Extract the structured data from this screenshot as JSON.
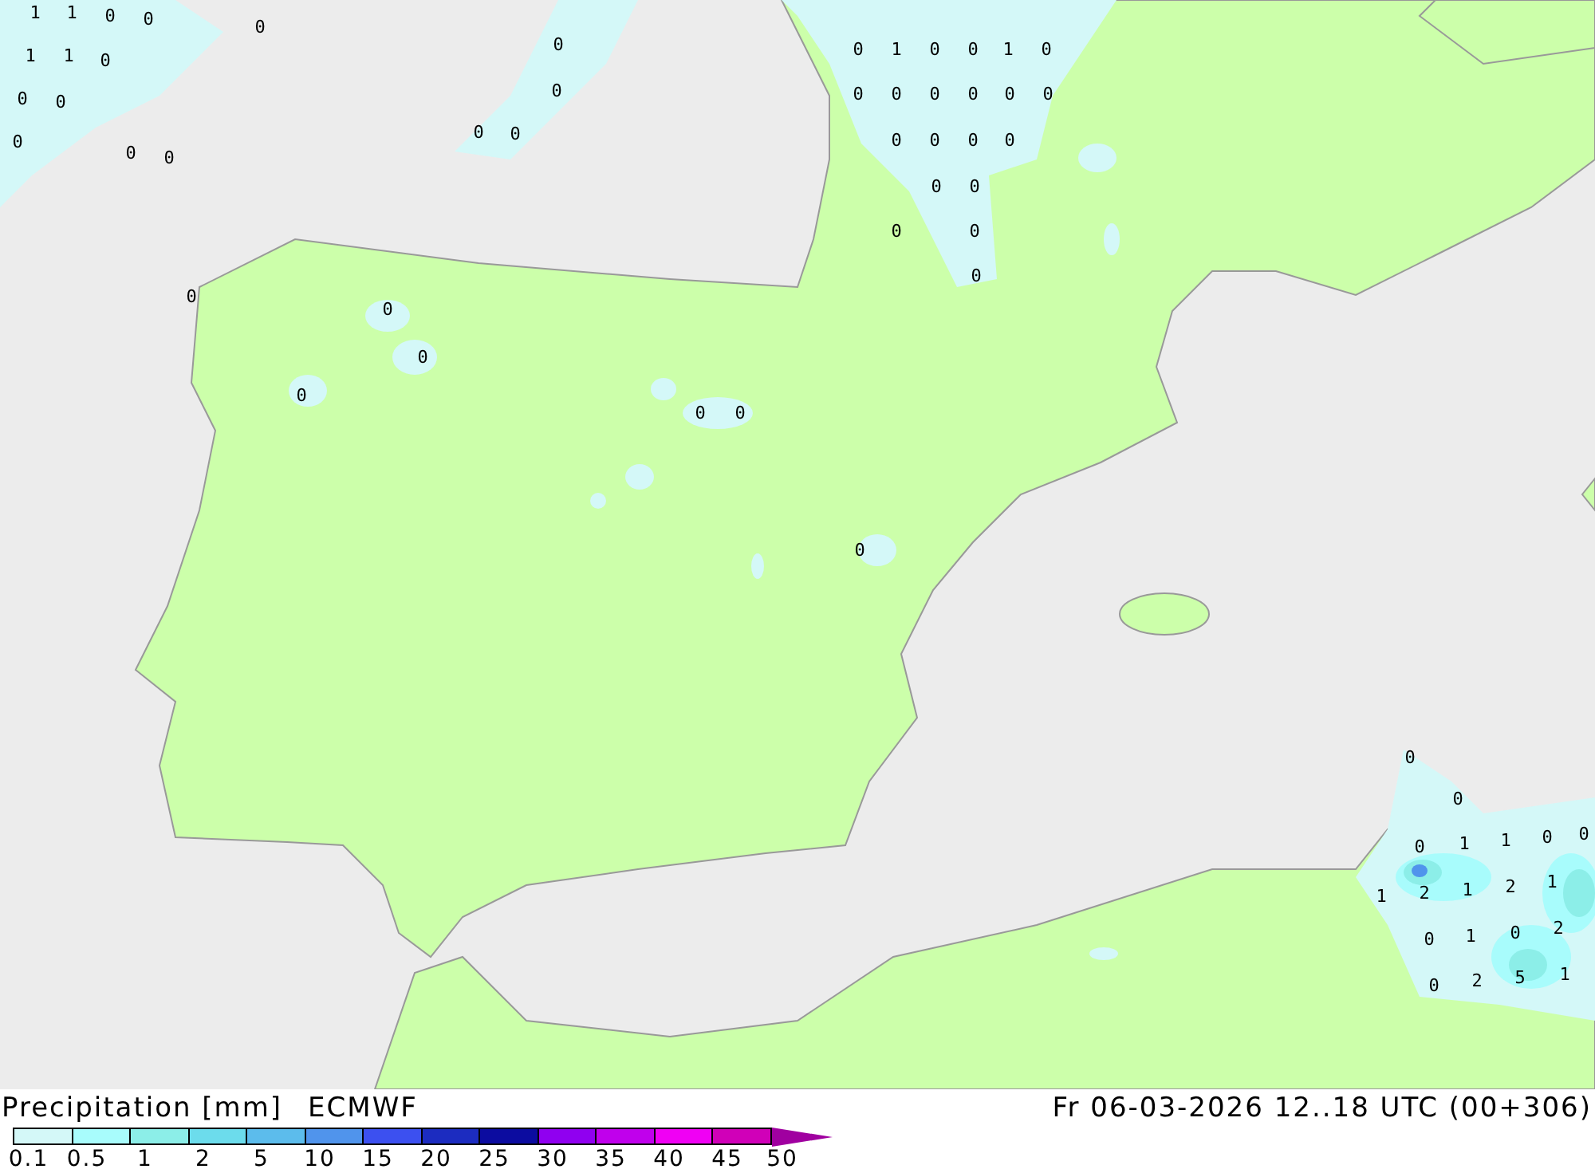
{
  "map": {
    "value_labels": [
      "1",
      "1",
      "0",
      "0",
      "1",
      "1",
      "0",
      "0",
      "0",
      "0",
      "0",
      "0",
      "0",
      "0",
      "0",
      "0",
      "0",
      "0",
      "1",
      "0",
      "0",
      "1",
      "0",
      "0",
      "0",
      "0",
      "0",
      "0",
      "0",
      "0",
      "0",
      "0",
      "0",
      "0",
      "0",
      "0",
      "0",
      "0",
      "0",
      "0",
      "0",
      "0",
      "0",
      "0",
      "0",
      "0",
      "0",
      "0",
      "1",
      "1",
      "0",
      "0",
      "1",
      "2",
      "1",
      "2",
      "1",
      "0",
      "1",
      "0",
      "2",
      "0",
      "2",
      "5",
      "1"
    ]
  },
  "legend": {
    "title": "Precipitation [mm]",
    "model": "ECMWF",
    "items": [
      {
        "label": "0.1",
        "color": "#d4f8f8"
      },
      {
        "label": "0.5",
        "color": "#a8fcfc"
      },
      {
        "label": "1",
        "color": "#8ceee8"
      },
      {
        "label": "2",
        "color": "#6cdcec"
      },
      {
        "label": "5",
        "color": "#5cbcec"
      },
      {
        "label": "10",
        "color": "#5094ec"
      },
      {
        "label": "15",
        "color": "#3c50f0"
      },
      {
        "label": "20",
        "color": "#1c2cc0"
      },
      {
        "label": "25",
        "color": "#0c0ca0"
      },
      {
        "label": "30",
        "color": "#9000f0"
      },
      {
        "label": "35",
        "color": "#c000ec"
      },
      {
        "label": "40",
        "color": "#f000f4"
      },
      {
        "label": "45",
        "color": "#d000b8"
      }
    ],
    "last_label": "50"
  },
  "timestamp": "Fr 06-03-2026 12..18 UTC (00+306)"
}
